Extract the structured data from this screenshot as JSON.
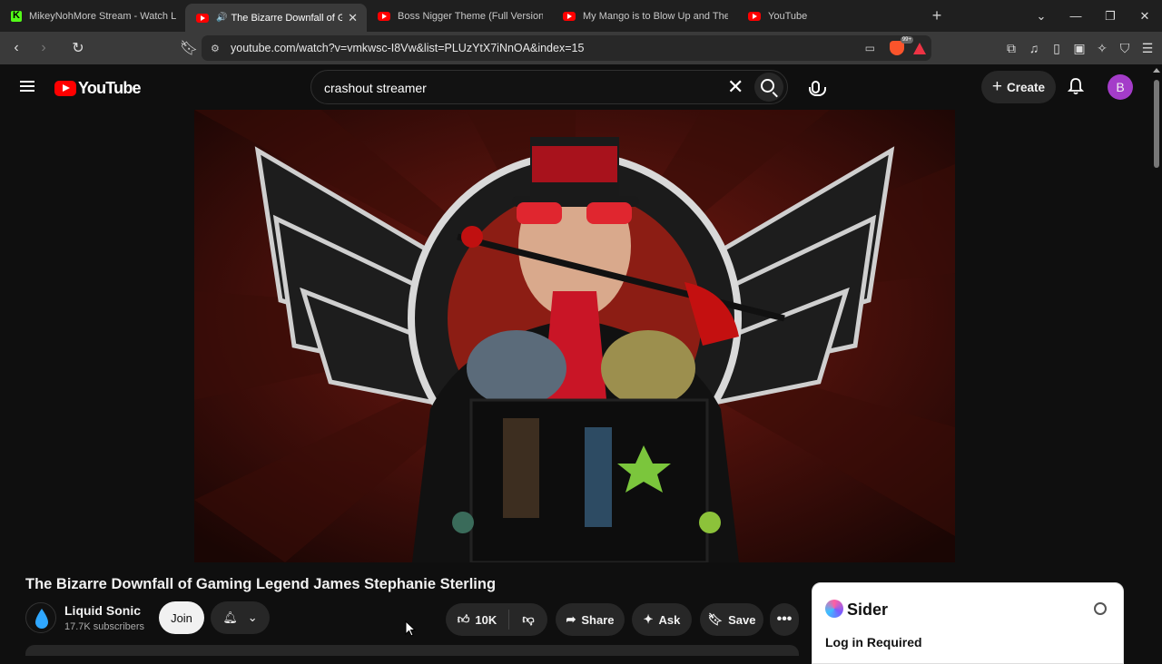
{
  "browser": {
    "tabs": [
      {
        "title": "MikeyNohMore Stream - Watch Live",
        "favicon": "kick-icon",
        "active": false
      },
      {
        "title": "The Bizarre Downfall of Gaming",
        "favicon": "youtube-icon",
        "active": true,
        "audio": true
      },
      {
        "title": "Boss Nigger Theme (Full Version Rem",
        "favicon": "youtube-icon",
        "active": false
      },
      {
        "title": "My Mango is to Blow Up and Then A",
        "favicon": "youtube-icon",
        "active": false
      },
      {
        "title": "YouTube",
        "favicon": "youtube-icon",
        "active": false
      }
    ],
    "url": "youtube.com/watch?v=vmkwsc-I8Vw&list=PLUzYtX7iNnOA&index=15",
    "brave_badge": "99+"
  },
  "youtube": {
    "logo_text": "YouTube",
    "search_value": "crashout streamer",
    "create_label": "Create",
    "avatar_letter": "B",
    "avatar_color": "#a43cc9"
  },
  "video": {
    "title": "The Bizarre Downfall of Gaming Legend James Stephanie Sterling",
    "channel": "Liquid Sonic",
    "subscribers": "17.7K subscribers",
    "join_label": "Join",
    "likes": "10K",
    "share_label": "Share",
    "ask_label": "Ask",
    "save_label": "Save"
  },
  "sider": {
    "name": "Sider",
    "message": "Log in Required"
  },
  "colors": {
    "accent_red": "#ff0000",
    "background": "#0f0f0f",
    "chip": "#272727"
  }
}
